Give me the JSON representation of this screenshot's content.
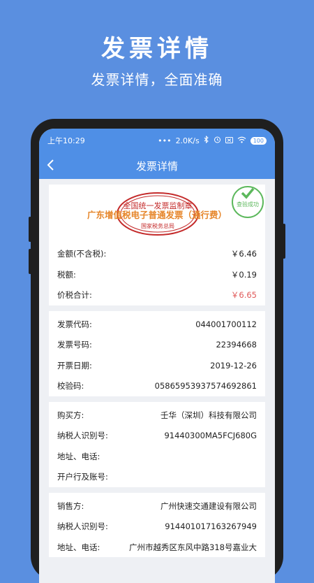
{
  "hero": {
    "title": "发票详情",
    "subtitle": "发票详情，全面准确"
  },
  "status_bar": {
    "time": "上午10:29",
    "dots": "•••",
    "speed": "2.0K/s",
    "battery": "100"
  },
  "nav": {
    "title": "发票详情"
  },
  "invoice": {
    "stamp_top": "全国统一发票监制章",
    "stamp_bottom": "国家税务总局",
    "name": "广东增值税电子普通发票（通行费）",
    "verified_label": "查验成功"
  },
  "amounts": [
    {
      "label": "金额(不含税):",
      "value": "￥6.46"
    },
    {
      "label": "税额:",
      "value": "￥0.19"
    },
    {
      "label": "价税合计:",
      "value": "￥6.65"
    }
  ],
  "invoice_info": [
    {
      "label": "发票代码:",
      "value": "044001700112"
    },
    {
      "label": "发票号码:",
      "value": "22394668"
    },
    {
      "label": "开票日期:",
      "value": "2019-12-26"
    },
    {
      "label": "校验码:",
      "value": "05865953937574692861"
    }
  ],
  "buyer": [
    {
      "label": "购买方:",
      "value": "壬华（深圳）科技有限公司"
    },
    {
      "label": "纳税人识别号:",
      "value": "91440300MA5FCJ680G"
    },
    {
      "label": "地址、电话:",
      "value": ""
    },
    {
      "label": "开户行及账号:",
      "value": ""
    }
  ],
  "seller": [
    {
      "label": "销售方:",
      "value": "广州快速交通建设有限公司"
    },
    {
      "label": "纳税人识别号:",
      "value": "914401017163267949"
    },
    {
      "label": "地址、电话:",
      "value": "广州市越秀区东风中路318号嘉业大"
    }
  ],
  "colors": {
    "background": "#5a8fe0",
    "header": "#4f8fe6",
    "total_red": "#e05a5a",
    "invoice_title": "#e6862a",
    "stamp_red": "#c42b2b",
    "verified_green": "#5cb85c"
  }
}
